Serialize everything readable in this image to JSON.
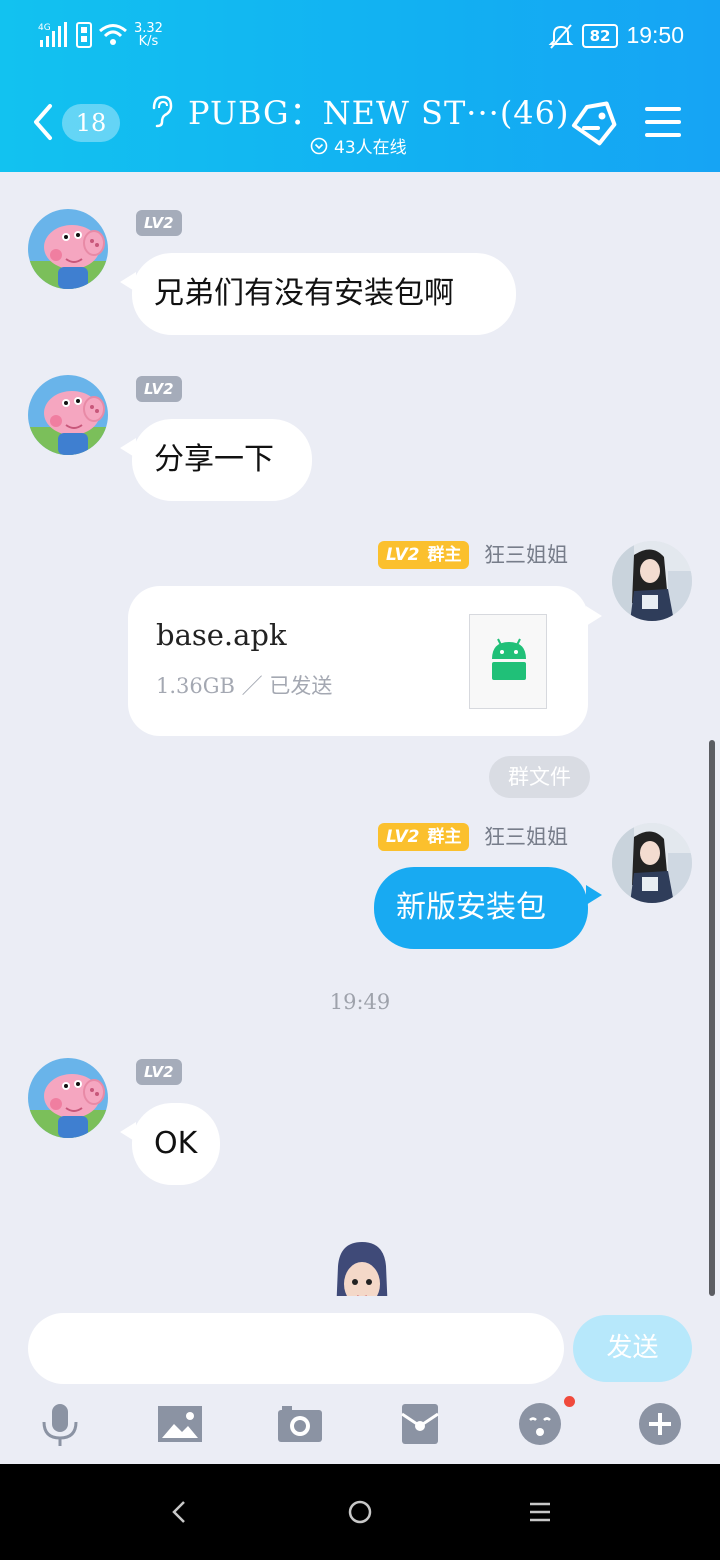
{
  "status_bar": {
    "net_speed_value": "3.32",
    "net_speed_unit": "K/s",
    "battery": "82",
    "time": "19:50"
  },
  "header": {
    "unread_count": "18",
    "title": "PUBG：NEW ST···(46)",
    "online_status": "43人在线"
  },
  "messages": [
    {
      "sender": "",
      "level": "LV2",
      "text": "兄弟们有没有安装包啊"
    },
    {
      "sender": "",
      "level": "LV2",
      "text": "分享一下"
    },
    {
      "sender": "狂三姐姐",
      "level": "LV2",
      "role": "群主",
      "file": {
        "name": "base.apk",
        "meta": "1.36GB ／ 已发送"
      }
    },
    {
      "sender": "狂三姐姐",
      "level": "LV2",
      "role": "群主",
      "text": "新版安装包"
    },
    {
      "level": "LV2",
      "text": "OK"
    }
  ],
  "group_file_chip": "群文件",
  "timestamp": "19:49",
  "input": {
    "placeholder": "",
    "send_label": "发送"
  },
  "toolbar": [
    "mic-icon",
    "image-icon",
    "camera-icon",
    "red-packet-icon",
    "emoji-icon",
    "plus-icon"
  ],
  "colors": {
    "header": "#12b6f2",
    "bubble_self": "#18aaf2",
    "owner_badge": "#fbc02d",
    "level_badge": "#a5acba"
  }
}
